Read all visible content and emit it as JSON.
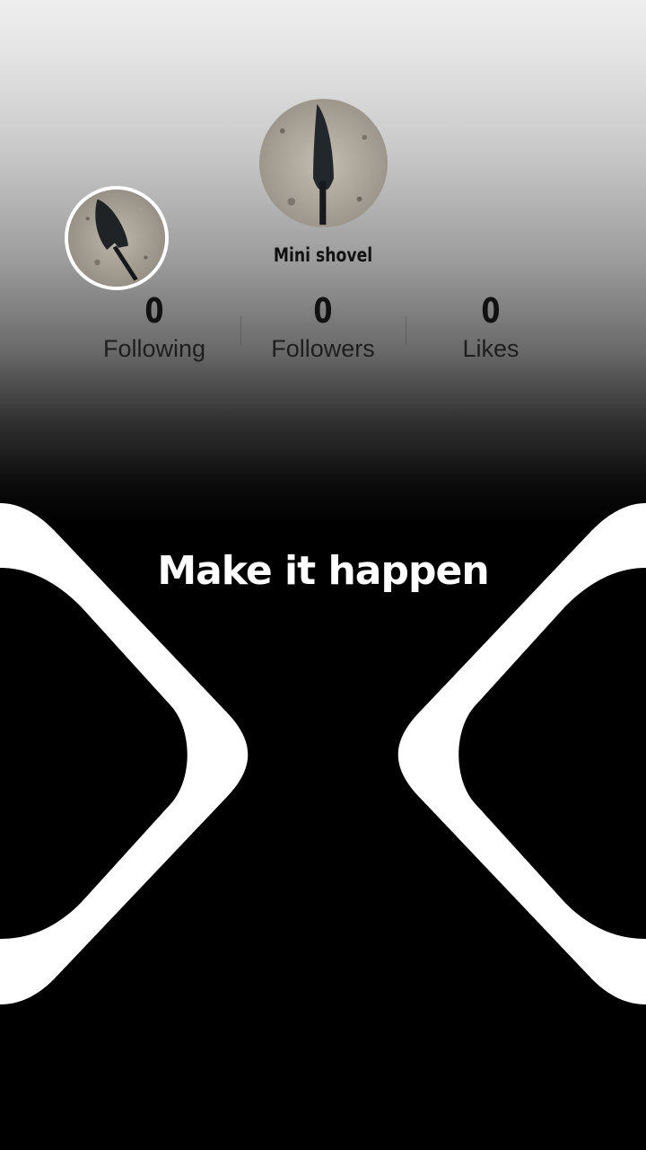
{
  "profile": {
    "username": "Mini shovel",
    "avatar_small": "shovel-photo",
    "avatar_large": "shovel-photo"
  },
  "stats": {
    "following": {
      "value": "0",
      "label": "Following"
    },
    "followers": {
      "value": "0",
      "label": "Followers"
    },
    "likes": {
      "value": "0",
      "label": "Likes"
    }
  },
  "headline": "Make it happen",
  "colors": {
    "background": "#000000",
    "text_dark": "#111111",
    "text_light": "#ffffff",
    "shape": "#ffffff"
  }
}
